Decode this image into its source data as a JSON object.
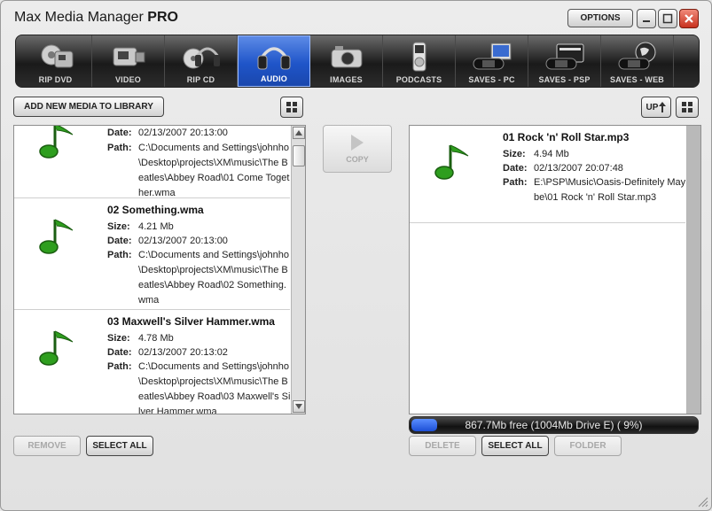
{
  "window": {
    "title_main": "Max Media Manager ",
    "title_bold": "PRO",
    "options_label": "OPTIONS"
  },
  "tabs": [
    {
      "label": "RIP DVD",
      "icon": "camcorder-icon"
    },
    {
      "label": "VIDEO",
      "icon": "camcorder-icon"
    },
    {
      "label": "RIP CD",
      "icon": "headphones-icon"
    },
    {
      "label": "AUDIO",
      "icon": "headphones-icon",
      "active": true
    },
    {
      "label": "IMAGES",
      "icon": "camera-icon"
    },
    {
      "label": "PODCASTS",
      "icon": "ipod-icon"
    },
    {
      "label": "SAVES - PC",
      "icon": "psp-monitor-icon"
    },
    {
      "label": "SAVES - PSP",
      "icon": "psp-card-icon"
    },
    {
      "label": "SAVES - WEB",
      "icon": "psp-globe-icon"
    }
  ],
  "library": {
    "add_label": "ADD NEW MEDIA TO LIBRARY",
    "items": [
      {
        "name": "",
        "size": "",
        "date": "02/13/2007 20:13:00",
        "path": "C:\\Documents and Settings\\johnho\\Desktop\\projects\\XM\\music\\The Beatles\\Abbey Road\\01 Come Together.wma"
      },
      {
        "name": "02 Something.wma",
        "size": "4.21 Mb",
        "date": "02/13/2007 20:13:00",
        "path": "C:\\Documents and Settings\\johnho\\Desktop\\projects\\XM\\music\\The Beatles\\Abbey Road\\02 Something.wma"
      },
      {
        "name": "03 Maxwell's Silver Hammer.wma",
        "size": "4.78 Mb",
        "date": "02/13/2007 20:13:02",
        "path": "C:\\Documents and Settings\\johnho\\Desktop\\projects\\XM\\music\\The Beatles\\Abbey Road\\03 Maxwell's Silver Hammer.wma"
      }
    ],
    "remove_label": "REMOVE",
    "select_all_label": "SELECT ALL"
  },
  "labels": {
    "size": "Size:",
    "date": "Date:",
    "path": "Path:"
  },
  "copy_label": "COPY",
  "device": {
    "up_label": "UP",
    "items": [
      {
        "name": "01 Rock 'n' Roll Star.mp3",
        "size": "4.94 Mb",
        "date": "02/13/2007 20:07:48",
        "path": "E:\\PSP\\Music\\Oasis-Definitely Maybe\\01 Rock 'n' Roll Star.mp3"
      }
    ],
    "free_text": "867.7Mb free (1004Mb Drive E) ( 9%)",
    "used_fraction": 0.09,
    "delete_label": "DELETE",
    "select_all_label": "SELECT ALL",
    "folder_label": "FOLDER"
  },
  "colors": {
    "accent": "#1f55c9",
    "note_green": "#2e9e1e"
  }
}
